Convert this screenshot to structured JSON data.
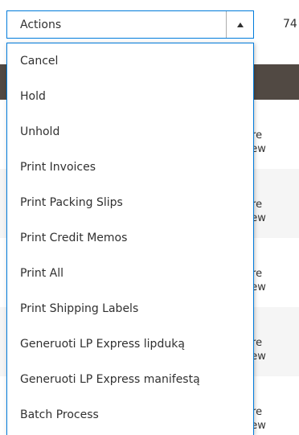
{
  "actions": {
    "label": "Actions",
    "records_count": "74",
    "menu_items": [
      "Cancel",
      "Hold",
      "Unhold",
      "Print Invoices",
      "Print Packing Slips",
      "Print Credit Memos",
      "Print All",
      "Print Shipping Labels",
      "Generuoti LP Express lipduką",
      "Generuoti LP Express manifestą",
      "Batch Process"
    ]
  },
  "grid": {
    "row_store_lines": [
      [
        "tore",
        "View"
      ],
      [
        "tore",
        "View"
      ],
      [
        "tore",
        "View"
      ],
      [
        "tore",
        "View"
      ],
      [
        "tore",
        "View"
      ]
    ]
  },
  "colors": {
    "accent_border": "#007bdb",
    "grid_header": "#514943",
    "row_shade": "#f5f5f5"
  }
}
